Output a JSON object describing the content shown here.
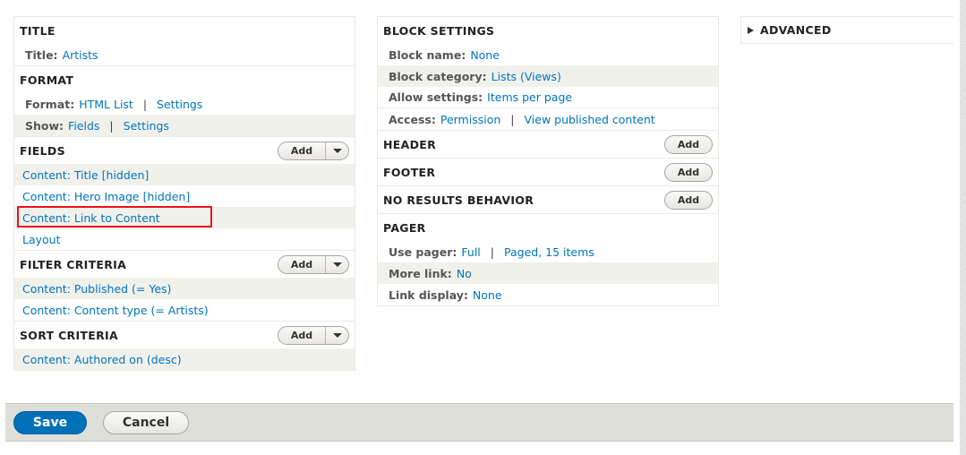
{
  "left": {
    "title": {
      "heading": "TITLE",
      "rows": [
        {
          "label": "Title:",
          "value": "Artists"
        }
      ]
    },
    "format": {
      "heading": "FORMAT",
      "rows": [
        {
          "label": "Format:",
          "value": "HTML List",
          "extra": "Settings"
        },
        {
          "label": "Show:",
          "value": "Fields",
          "extra": "Settings"
        }
      ]
    },
    "fields": {
      "heading": "FIELDS",
      "add_label": "Add",
      "items": [
        "Content: Title [hidden]",
        "Content: Hero Image [hidden]",
        "Content: Link to Content",
        "Layout"
      ]
    },
    "filter": {
      "heading": "FILTER CRITERIA",
      "add_label": "Add",
      "items": [
        "Content: Published (= Yes)",
        "Content: Content type (= Artists)"
      ]
    },
    "sort": {
      "heading": "SORT CRITERIA",
      "add_label": "Add",
      "items": [
        "Content: Authored on (desc)"
      ]
    }
  },
  "middle": {
    "block": {
      "heading": "BLOCK SETTINGS",
      "rows": [
        {
          "label": "Block name:",
          "value": "None"
        },
        {
          "label": "Block category:",
          "value": "Lists (Views)"
        },
        {
          "label": "Allow settings:",
          "value": "Items per page"
        },
        {
          "label": "Access:",
          "value": "Permission",
          "extra": "View published content"
        }
      ]
    },
    "header": {
      "heading": "HEADER",
      "add_label": "Add"
    },
    "footer": {
      "heading": "FOOTER",
      "add_label": "Add"
    },
    "no_results": {
      "heading": "NO RESULTS BEHAVIOR",
      "add_label": "Add"
    },
    "pager": {
      "heading": "PAGER",
      "rows": [
        {
          "label": "Use pager:",
          "value": "Full",
          "extra": "Paged, 15 items"
        },
        {
          "label": "More link:",
          "value": "No"
        },
        {
          "label": "Link display:",
          "value": "None"
        }
      ]
    }
  },
  "right": {
    "advanced": {
      "heading": "ADVANCED"
    }
  },
  "actions": {
    "save_label": "Save",
    "cancel_label": "Cancel"
  },
  "separator": "|",
  "colors": {
    "link": "#0074bd",
    "primary": "#0071b8",
    "highlight": "#e8141a"
  }
}
